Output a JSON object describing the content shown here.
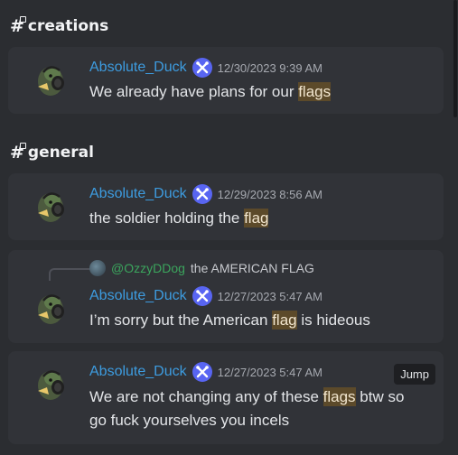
{
  "sections": [
    {
      "channel": "creations",
      "messages": [
        {
          "author": "Absolute_Duck",
          "timestamp": "12/30/2023 9:39 AM",
          "text_before": "We already have plans for our ",
          "highlight": "flags",
          "text_after": ""
        }
      ]
    },
    {
      "channel": "general",
      "messages": [
        {
          "author": "Absolute_Duck",
          "timestamp": "12/29/2023 8:56 AM",
          "text_before": "the soldier holding the ",
          "highlight": "flag",
          "text_after": ""
        },
        {
          "reply_to": {
            "mention": "@OzzyDDog",
            "text": "the AMERICAN FLAG"
          },
          "author": "Absolute_Duck",
          "timestamp": "12/27/2023 5:47 AM",
          "text_before": "I’m sorry but the American ",
          "highlight": "flag",
          "text_after": " is hideous"
        },
        {
          "author": "Absolute_Duck",
          "timestamp": "12/27/2023 5:47 AM",
          "text_before": "We are not changing any of these ",
          "highlight": "flags",
          "text_after": " btw so go fuck yourselves you incels",
          "jump_label": "Jump"
        }
      ]
    }
  ],
  "colors": {
    "background": "#2b2d31",
    "card": "#313338",
    "author": "#3d9ce0",
    "highlight_bg": "#5c4a2a",
    "mention": "#3ba55d",
    "badge": "#5865f2"
  },
  "icons": {
    "channel": "hash-lock-icon",
    "badge": "crossed-tools-icon",
    "avatar": "duck-headphones-avatar"
  }
}
